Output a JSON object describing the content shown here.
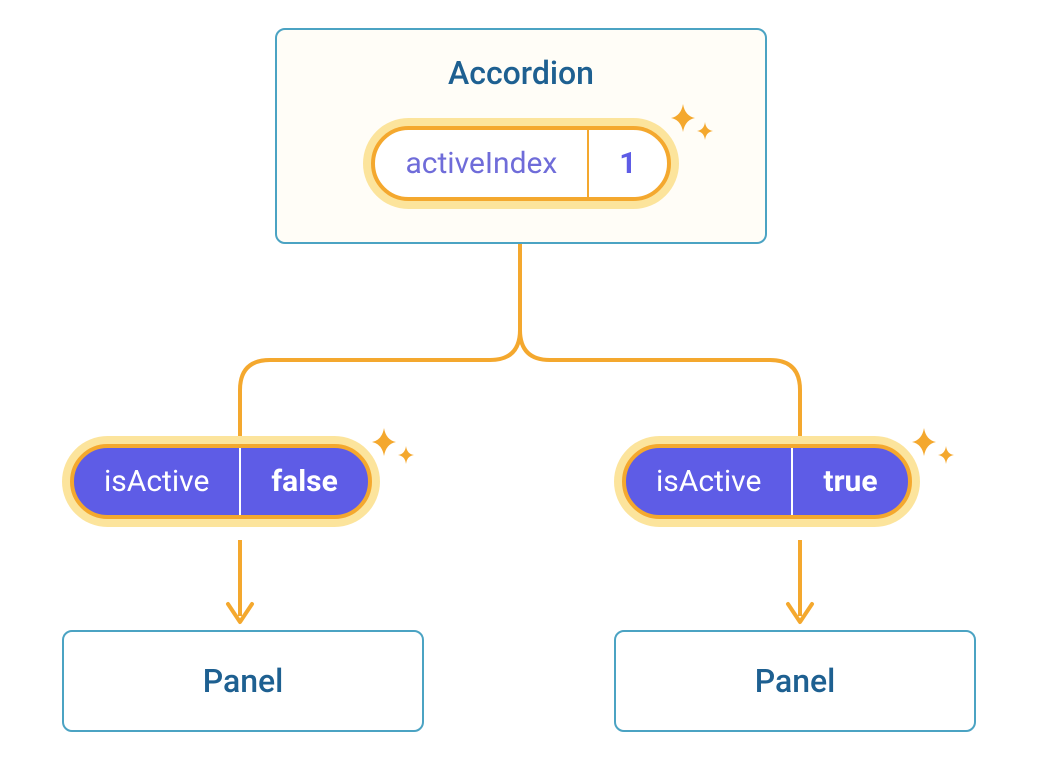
{
  "accordion": {
    "title": "Accordion",
    "state": {
      "label": "activeIndex",
      "value": "1"
    }
  },
  "children": [
    {
      "prop": {
        "label": "isActive",
        "value": "false"
      },
      "panel": "Panel"
    },
    {
      "prop": {
        "label": "isActive",
        "value": "true"
      },
      "panel": "Panel"
    }
  ],
  "colors": {
    "blue_border": "#4ba3c3",
    "blue_text": "#1e6091",
    "orange": "#f4a82e",
    "orange_light": "#fce49c",
    "purple": "#5e5ce6",
    "purple_light": "#6f6cd9"
  }
}
